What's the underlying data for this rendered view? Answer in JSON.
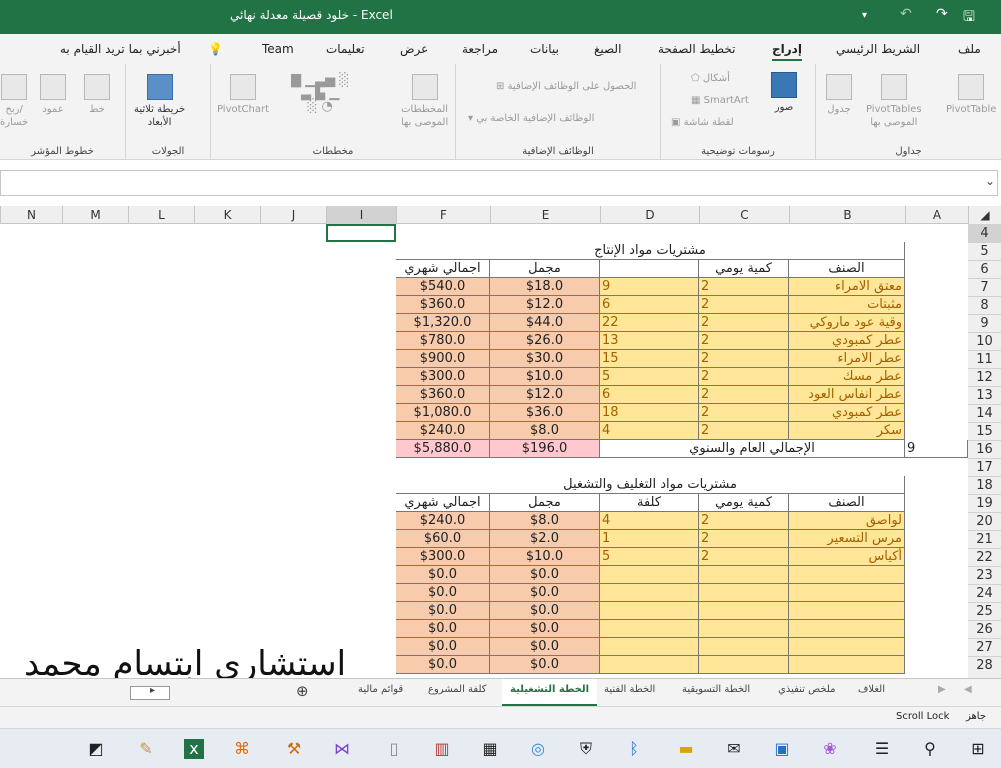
{
  "titlebar": {
    "title": "خلود قصيلة معدلة نهائي  -  Excel",
    "save_icon": "save-icon",
    "redo_icon": "redo-icon",
    "undo_icon": "undo-icon"
  },
  "menu": {
    "file": "ملف",
    "home": "الشريط الرئيسي",
    "insert": "إدراج",
    "layout": "تخطيط الصفحة",
    "formulas": "الصيغ",
    "data": "بيانات",
    "review": "مراجعة",
    "view": "عرض",
    "help": "تعليمات",
    "team": "Team",
    "tellme": "أخبرني بما تريد القيام به"
  },
  "ribbon": {
    "tables_group": "جداول",
    "pivottable": "PivotTable",
    "recommended_pivot_1": "PivotTables",
    "recommended_pivot_2": "الموصى بها",
    "table": "جدول",
    "illustrations_group": "رسومات توضيحية",
    "pictures": "صور",
    "shapes": "أشكال",
    "smartart": "SmartArt",
    "screenshot": "لقطة شاشة",
    "addins_group": "الوظائف الإضافية",
    "get_addins": "الحصول على الوظائف الإضافية",
    "my_addins": "الوظائف الإضافية الخاصة بي",
    "charts_group": "مخططات",
    "recommended_charts_1": "المخططات",
    "recommended_charts_2": "الموصى بها",
    "pivotchart": "PivotChart",
    "tours_group": "الجولات",
    "map3d_1": "خريطة ثلاثية",
    "map3d_2": "الأبعاد",
    "sparklines_group": "خطوط المؤشر",
    "line": "خط",
    "column": "عمود",
    "winloss_1": "ربح/",
    "winloss_2": "خسارة"
  },
  "columns": [
    "A",
    "B",
    "C",
    "D",
    "E",
    "F",
    "I",
    "J",
    "K",
    "L",
    "M",
    "N"
  ],
  "rows": [
    "4",
    "5",
    "6",
    "7",
    "8",
    "9",
    "10",
    "11",
    "12",
    "13",
    "14",
    "15",
    "16",
    "17",
    "18",
    "19",
    "20",
    "21",
    "22",
    "23",
    "24",
    "25",
    "26",
    "27",
    "28"
  ],
  "table1": {
    "title": "مشتريات مواد الإنتاج",
    "headers": {
      "item": "الصنف",
      "daily_qty": "كمية يومي",
      "total": "مجمل",
      "monthly_total": "اجمالي شهري"
    },
    "rows": [
      {
        "item": "معتق الامراء",
        "qty": "2",
        "d": "9",
        "total": "$18.0",
        "monthly": "$540.0"
      },
      {
        "item": "مثبتات",
        "qty": "2",
        "d": "6",
        "total": "$12.0",
        "monthly": "$360.0"
      },
      {
        "item": "وقية عود ماروكي",
        "qty": "2",
        "d": "22",
        "total": "$44.0",
        "monthly": "$1,320.0"
      },
      {
        "item": "عطر كمبودي",
        "qty": "2",
        "d": "13",
        "total": "$26.0",
        "monthly": "$780.0"
      },
      {
        "item": "عطر الامراء",
        "qty": "2",
        "d": "15",
        "total": "$30.0",
        "monthly": "$900.0"
      },
      {
        "item": "عطر مسك",
        "qty": "2",
        "d": "5",
        "total": "$10.0",
        "monthly": "$300.0"
      },
      {
        "item": "عطر انفاس العود",
        "qty": "2",
        "d": "6",
        "total": "$12.0",
        "monthly": "$360.0"
      },
      {
        "item": "عطر كمبودي",
        "qty": "2",
        "d": "18",
        "total": "$36.0",
        "monthly": "$1,080.0"
      },
      {
        "item": "سكر",
        "qty": "2",
        "d": "4",
        "total": "$8.0",
        "monthly": "$240.0"
      }
    ],
    "grand_total_label": "الإجمالي العام والسنوي",
    "grand_total": "$196.0",
    "grand_monthly": "$5,880.0",
    "a16": "9"
  },
  "table2": {
    "title": "مشتريات مواد التغليف والتشغيل",
    "headers": {
      "item": "الصنف",
      "daily_qty": "كمية يومي",
      "cost": "كلفة",
      "total": "مجمل",
      "monthly_total": "اجمالي شهري"
    },
    "rows": [
      {
        "item": "لواصق",
        "qty": "2",
        "d": "4",
        "total": "$8.0",
        "monthly": "$240.0"
      },
      {
        "item": "مرس التسعير",
        "qty": "2",
        "d": "1",
        "total": "$2.0",
        "monthly": "$60.0"
      },
      {
        "item": "أكياس",
        "qty": "2",
        "d": "5",
        "total": "$10.0",
        "monthly": "$300.0"
      },
      {
        "item": "",
        "qty": "",
        "d": "",
        "total": "$0.0",
        "monthly": "$0.0"
      },
      {
        "item": "",
        "qty": "",
        "d": "",
        "total": "$0.0",
        "monthly": "$0.0"
      },
      {
        "item": "",
        "qty": "",
        "d": "",
        "total": "$0.0",
        "monthly": "$0.0"
      },
      {
        "item": "",
        "qty": "",
        "d": "",
        "total": "$0.0",
        "monthly": "$0.0"
      },
      {
        "item": "",
        "qty": "",
        "d": "",
        "total": "$0.0",
        "monthly": "$0.0"
      },
      {
        "item": "",
        "qty": "",
        "d": "",
        "total": "$0.0",
        "monthly": "$0.0"
      }
    ]
  },
  "signature": "استشاري  ابتسام  محمد",
  "sheet_tabs": [
    "الغلاف",
    "ملخص تنفيذي",
    "الخطة التسويقية",
    "الخطة الفنية",
    "الخطة التشغيلية",
    "كلفة المشروع",
    "قوائم مالية"
  ],
  "active_sheet": "الخطة التشغيلية",
  "status": {
    "ready": "جاهز",
    "scroll_lock": "Scroll Lock"
  },
  "colors": {
    "excel_green": "#217346",
    "orange_cell": "#f8cbad",
    "yellow_cell": "#ffe699",
    "pink_cell": "#ffc7ce"
  }
}
